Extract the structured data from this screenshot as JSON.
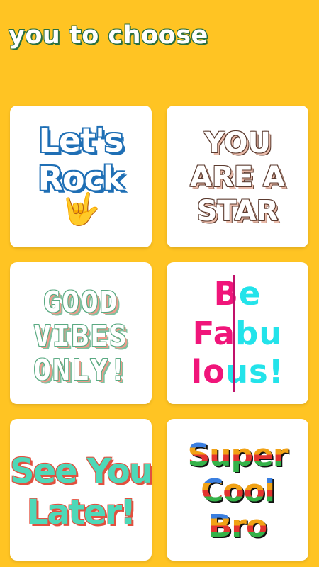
{
  "header": {
    "title": "you to choose"
  },
  "cards": [
    {
      "lines": [
        "Let's",
        "Rock"
      ],
      "emoji": "🤟"
    },
    {
      "lines": [
        "YOU",
        "ARE A",
        "STAR"
      ]
    },
    {
      "lines": [
        "GOOD",
        "VIBES",
        "ONLY!"
      ]
    },
    {
      "lines": [
        {
          "left": "B",
          "right": "e"
        },
        {
          "left": "Fa",
          "right": "bu"
        },
        {
          "left": "lo",
          "right": "us!"
        }
      ]
    },
    {
      "lines": [
        "See You",
        "Later!"
      ]
    },
    {
      "lines": [
        "Super",
        "Cool",
        "Bro"
      ]
    }
  ],
  "colors": {
    "background": "#FFC423",
    "card": "#FFFFFF",
    "pink": "#F0157A",
    "cyan": "#23E3EA"
  }
}
